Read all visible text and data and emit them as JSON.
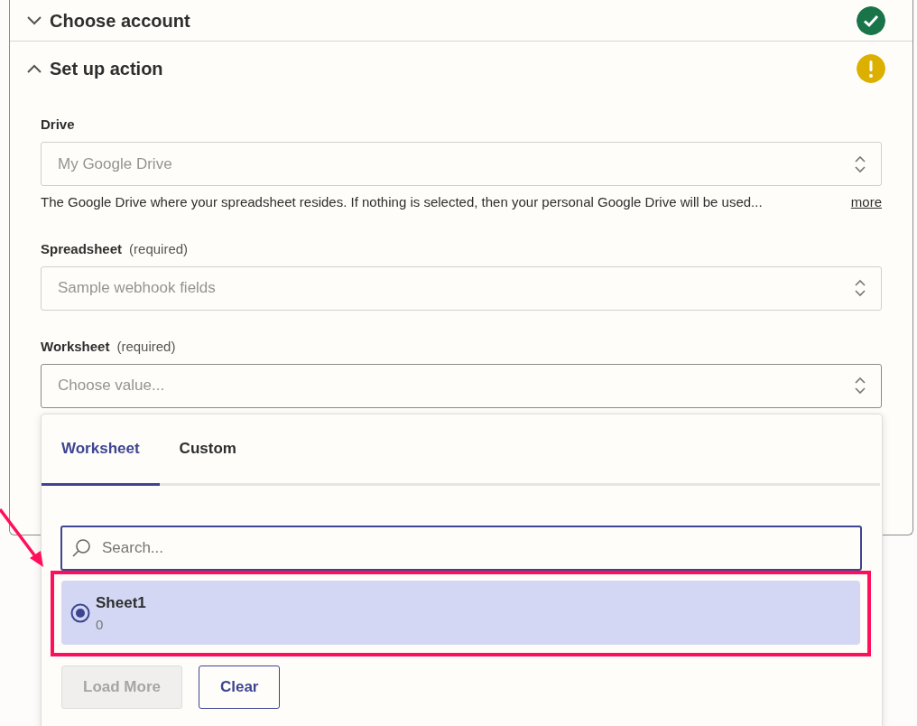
{
  "sections": [
    {
      "title": "Choose account",
      "expanded": false,
      "done": true
    },
    {
      "title": "Set up action",
      "expanded": true,
      "done": false
    }
  ],
  "fields": [
    {
      "label": "Drive",
      "placeholder": "My Google Drive",
      "help": "The Google Drive where your spreadsheet resides. If nothing is selected, then your personal Google Drive will be used...",
      "more": "more"
    },
    {
      "label": "Spreadsheet",
      "required": "(required)",
      "placeholder": "Sample webhook fields"
    },
    {
      "label": "Worksheet",
      "required": "(required)",
      "placeholder": "Choose value..."
    }
  ],
  "dropdown": {
    "tabs": [
      {
        "label": "Worksheet",
        "selected": true
      },
      {
        "label": "Custom",
        "selected": false
      }
    ],
    "search": {
      "placeholder": "Search..."
    },
    "options": [
      {
        "title": "Sheet1",
        "subtitle": "0",
        "selected": true
      }
    ],
    "buttons": [
      {
        "label": "Load More",
        "disabled": true
      },
      {
        "label": "Clear",
        "disabled": false
      }
    ]
  }
}
